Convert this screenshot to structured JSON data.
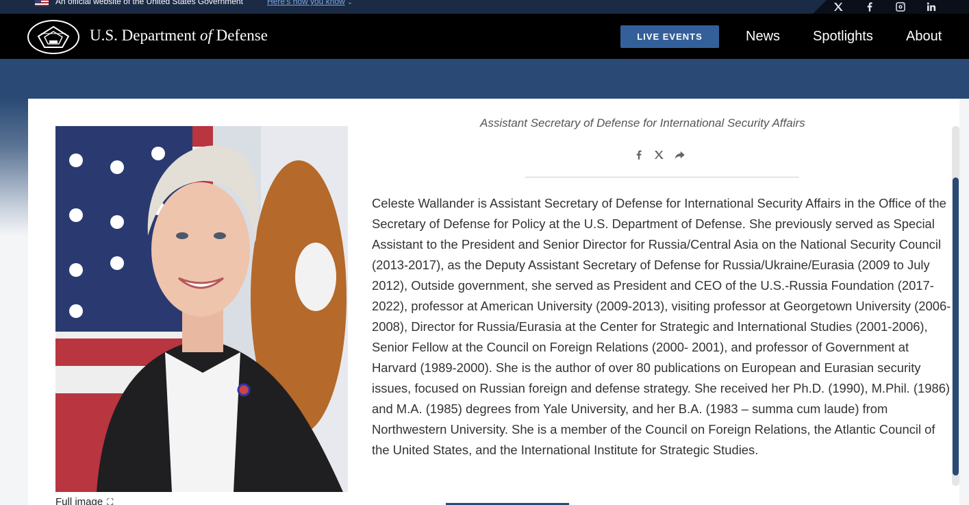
{
  "gov_banner": {
    "official_text": "An official website of the United States Government",
    "how_you_know": "Here's how you know"
  },
  "social": [
    {
      "name": "x-icon"
    },
    {
      "name": "facebook-icon"
    },
    {
      "name": "instagram-icon"
    },
    {
      "name": "linkedin-icon"
    }
  ],
  "header": {
    "title_part1": "U.S. Department ",
    "title_of": "of",
    "title_part2": " Defense",
    "live_events": "LIVE EVENTS",
    "nav": [
      "News",
      "Spotlights",
      "About"
    ]
  },
  "profile": {
    "subtitle": "Assistant Secretary of Defense for International Security Affairs",
    "full_image_label": "Full image",
    "bio": "Celeste Wallander is Assistant Secretary of Defense for International Security Affairs in the Office of the Secretary of Defense for Policy at the U.S. Department of Defense.  She previously served as Special Assistant to the President and Senior Director for Russia/Central Asia on the National Security Council (2013-2017), as the Deputy Assistant Secretary of Defense for Russia/Ukraine/Eurasia (2009 to July 2012),  Outside government, she served as President and CEO of the U.S.-Russia Foundation (2017-2022), professor at American University (2009-2013), visiting professor at Georgetown University (2006-2008), Director for Russia/Eurasia at the Center for Strategic and International Studies (2001-2006), Senior Fellow at the Council on Foreign Relations (2000- 2001), and professor of Government at Harvard (1989-2000).  She is the author of over 80 publications on European and Eurasian security issues, focused on Russian foreign and defense strategy. She received her Ph.D. (1990), M.Phil. (1986) and M.A. (1985) degrees from Yale University, and her B.A. (1983 – summa cum laude) from Northwestern University.  She is a member of the Council on Foreign Relations, the Atlantic Council of the United States, and the International Institute for Strategic Studies."
  },
  "colors": {
    "navy": "#1b2b45",
    "accent_blue": "#34609a",
    "band_blue": "#2a4a75"
  }
}
